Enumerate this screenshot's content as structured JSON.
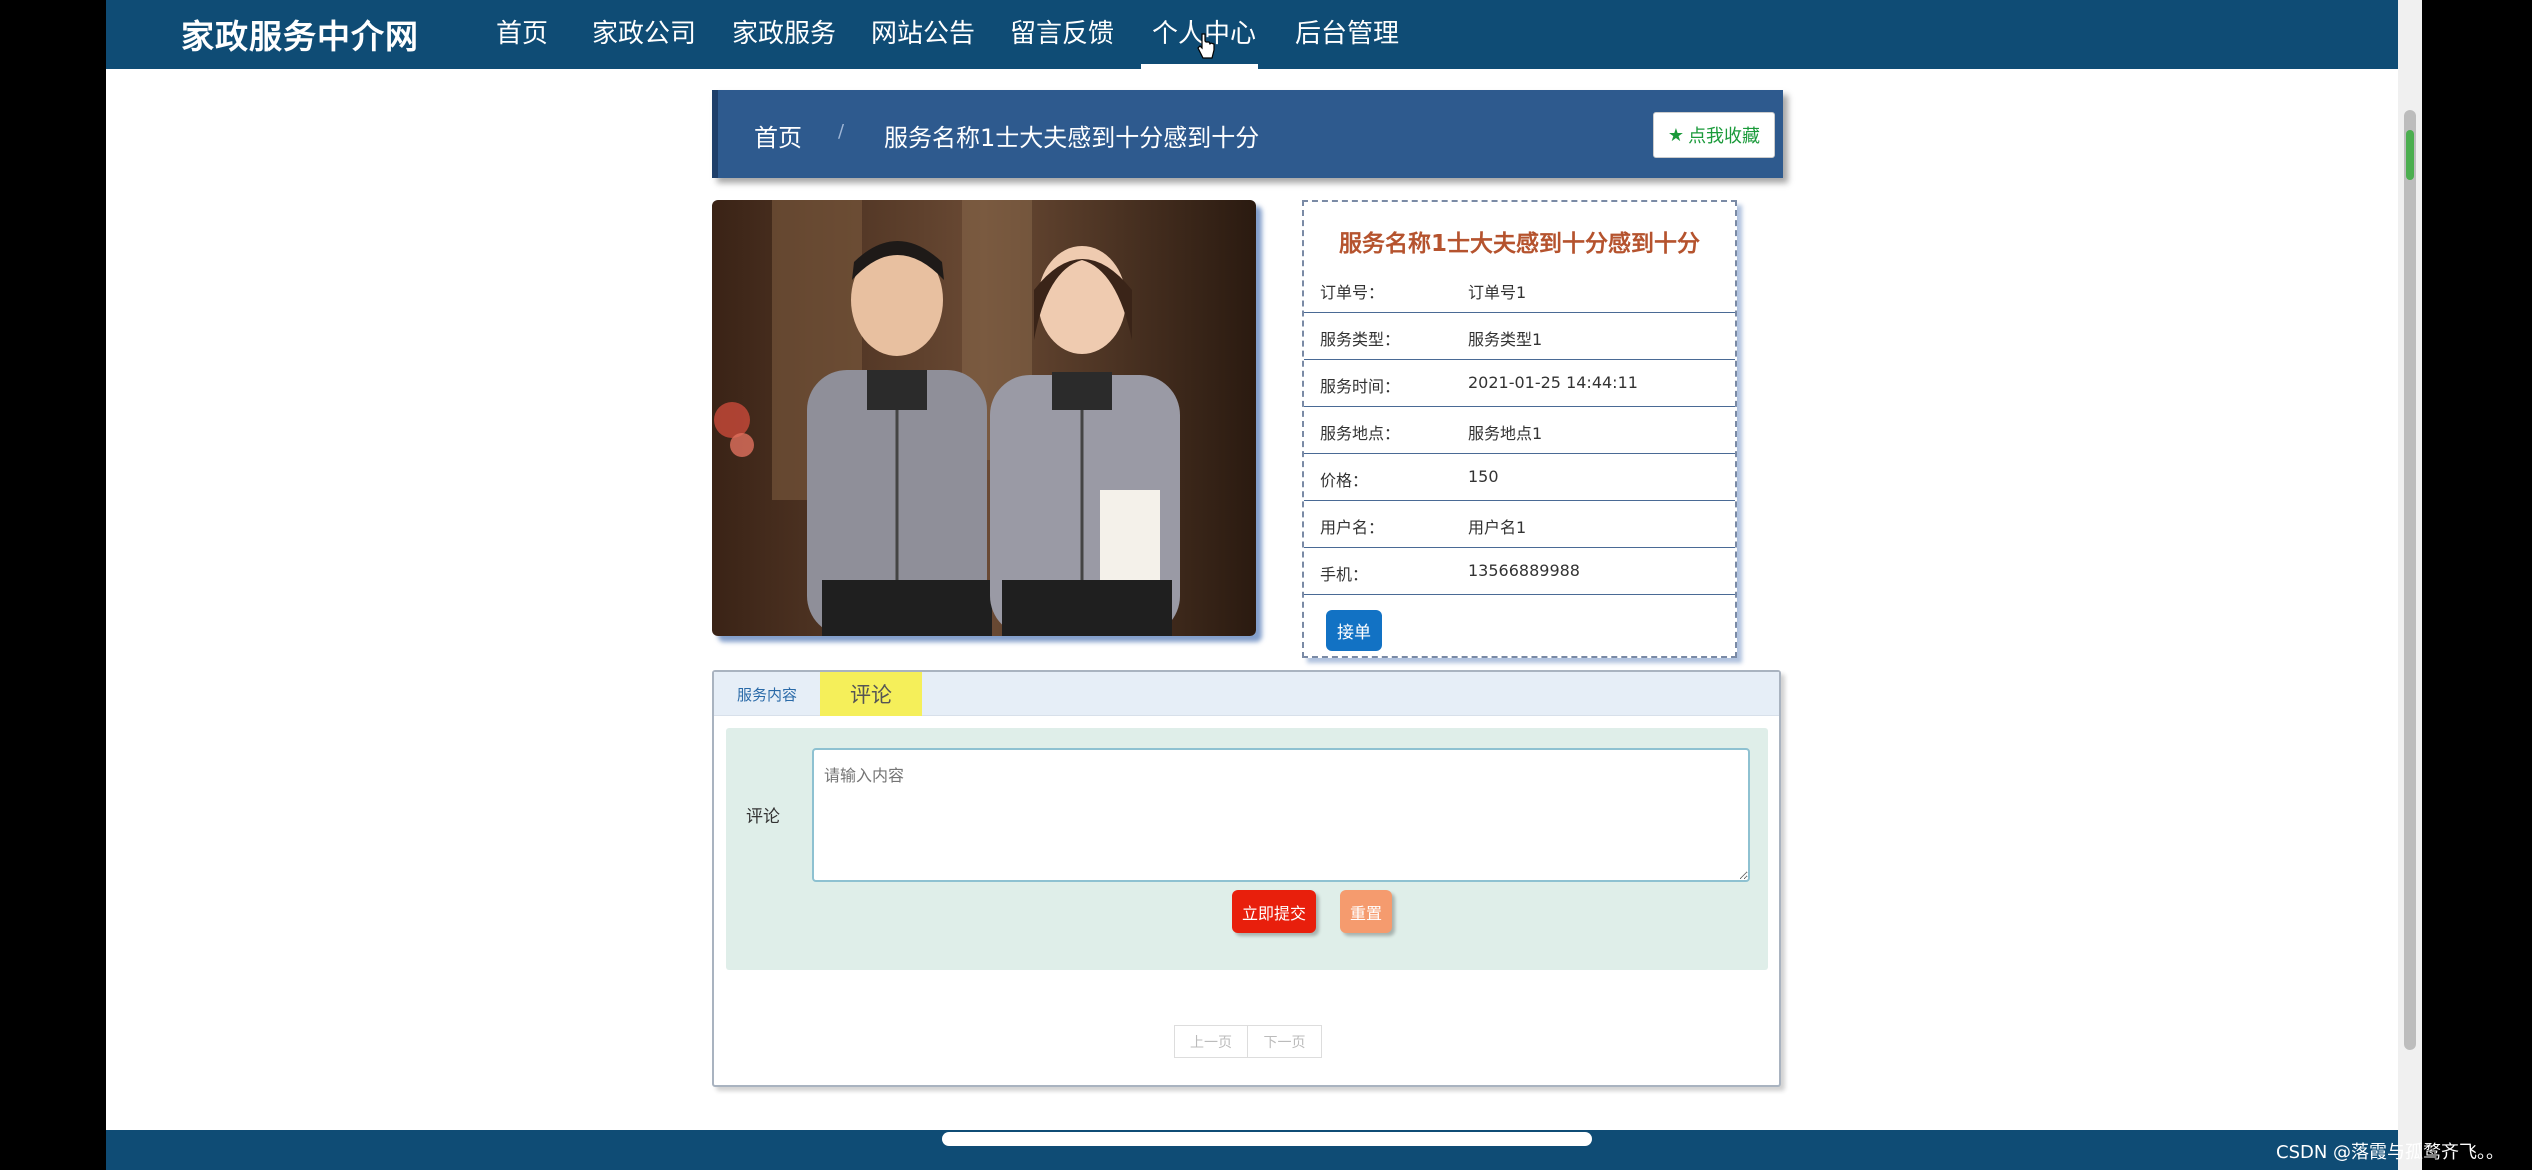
{
  "header": {
    "site_title": "家政服务中介网",
    "nav": [
      "首页",
      "家政公司",
      "家政服务",
      "网站公告",
      "留言反馈",
      "个人中心",
      "后台管理"
    ],
    "active_nav": "个人中心"
  },
  "breadcrumb": {
    "home": "首页",
    "separator": "/",
    "current": "服务名称1士大夫感到十分感到十分",
    "favorite_button": "点我收藏"
  },
  "detail": {
    "title": "服务名称1士大夫感到十分感到十分",
    "rows": [
      {
        "label": "订单号：",
        "value": "订单号1"
      },
      {
        "label": "服务类型：",
        "value": "服务类型1"
      },
      {
        "label": "服务时间：",
        "value": "2021-01-25 14:44:11"
      },
      {
        "label": "服务地点：",
        "value": "服务地点1"
      },
      {
        "label": "价格：",
        "value": "150"
      },
      {
        "label": "用户名：",
        "value": "用户名1"
      },
      {
        "label": "手机：",
        "value": "13566889988"
      }
    ],
    "take_order_button": "接单"
  },
  "tabs": {
    "service_content": "服务内容",
    "comment": "评论",
    "active": "评论"
  },
  "comment_form": {
    "label": "评论",
    "placeholder": "请输入内容",
    "submit": "立即提交",
    "reset": "重置"
  },
  "pager": {
    "prev": "上一页",
    "next": "下一页"
  },
  "watermark": "CSDN @落霞与孤鹜齐飞。。",
  "colors": {
    "nav_bg": "#0f4c75",
    "breadcrumb_bg": "#2e5a8e",
    "title_color": "#b5532e",
    "submit_red": "#e81f0c",
    "reset_orange": "#f59b6e",
    "take_order_blue": "#1272c4",
    "tab_highlight": "#f5ef5a"
  },
  "icons": {
    "favorite": "star-icon",
    "cursor": "hand-pointer-icon"
  }
}
